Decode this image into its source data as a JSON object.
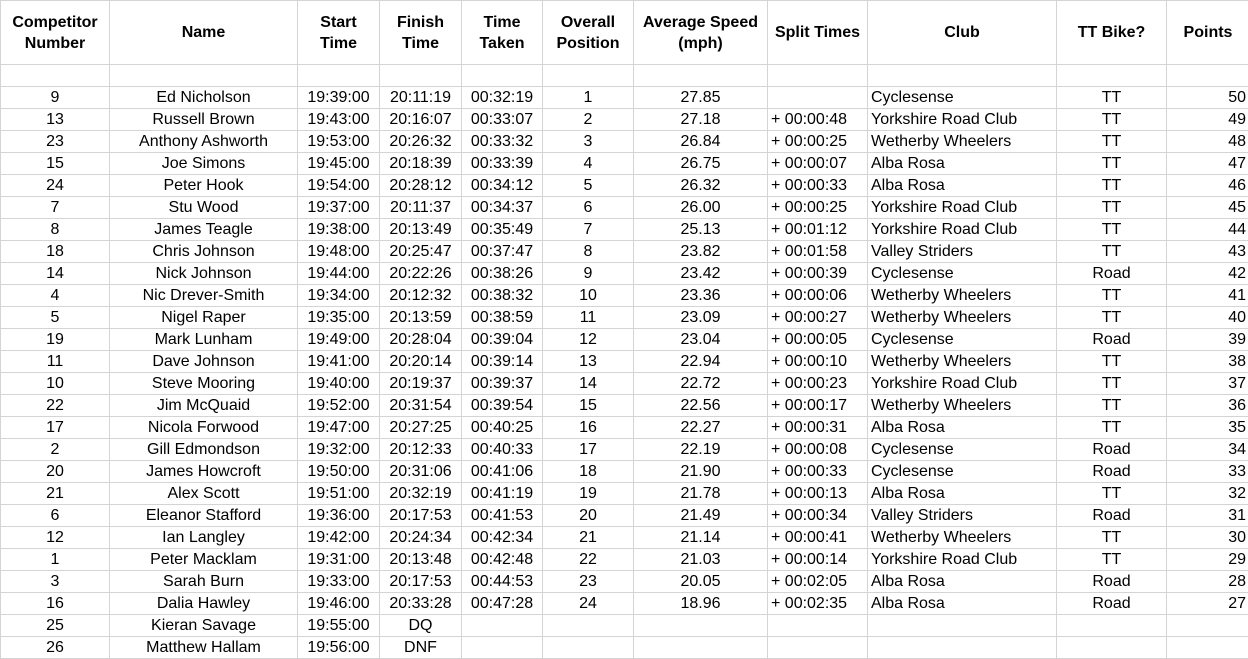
{
  "sheet": {
    "headers": [
      "Competitor Number",
      "Name",
      "Start Time",
      "Finish Time",
      "Time Taken",
      "Overall Position",
      "Average Speed (mph)",
      "Split Times",
      "Club",
      "TT Bike?",
      "Points"
    ],
    "rows": [
      {
        "number": "9",
        "name": "Ed Nicholson",
        "start": "19:39:00",
        "finish": "20:11:19",
        "taken": "00:32:19",
        "position": "1",
        "speed": "27.85",
        "split": "",
        "club": "Cyclesense",
        "bike": "TT",
        "points": "50"
      },
      {
        "number": "13",
        "name": "Russell Brown",
        "start": "19:43:00",
        "finish": "20:16:07",
        "taken": "00:33:07",
        "position": "2",
        "speed": "27.18",
        "split": "+ 00:00:48",
        "club": "Yorkshire Road Club",
        "bike": "TT",
        "points": "49"
      },
      {
        "number": "23",
        "name": "Anthony Ashworth",
        "start": "19:53:00",
        "finish": "20:26:32",
        "taken": "00:33:32",
        "position": "3",
        "speed": "26.84",
        "split": "+ 00:00:25",
        "club": "Wetherby Wheelers",
        "bike": "TT",
        "points": "48"
      },
      {
        "number": "15",
        "name": "Joe Simons",
        "start": "19:45:00",
        "finish": "20:18:39",
        "taken": "00:33:39",
        "position": "4",
        "speed": "26.75",
        "split": "+ 00:00:07",
        "club": "Alba Rosa",
        "bike": "TT",
        "points": "47"
      },
      {
        "number": "24",
        "name": "Peter Hook",
        "start": "19:54:00",
        "finish": "20:28:12",
        "taken": "00:34:12",
        "position": "5",
        "speed": "26.32",
        "split": "+ 00:00:33",
        "club": "Alba Rosa",
        "bike": "TT",
        "points": "46"
      },
      {
        "number": "7",
        "name": "Stu Wood",
        "start": "19:37:00",
        "finish": "20:11:37",
        "taken": "00:34:37",
        "position": "6",
        "speed": "26.00",
        "split": "+ 00:00:25",
        "club": "Yorkshire Road Club",
        "bike": "TT",
        "points": "45"
      },
      {
        "number": "8",
        "name": "James Teagle",
        "start": "19:38:00",
        "finish": "20:13:49",
        "taken": "00:35:49",
        "position": "7",
        "speed": "25.13",
        "split": "+ 00:01:12",
        "club": "Yorkshire Road Club",
        "bike": "TT",
        "points": "44"
      },
      {
        "number": "18",
        "name": "Chris Johnson",
        "start": "19:48:00",
        "finish": "20:25:47",
        "taken": "00:37:47",
        "position": "8",
        "speed": "23.82",
        "split": "+ 00:01:58",
        "club": "Valley Striders",
        "bike": "TT",
        "points": "43"
      },
      {
        "number": "14",
        "name": "Nick Johnson",
        "start": "19:44:00",
        "finish": "20:22:26",
        "taken": "00:38:26",
        "position": "9",
        "speed": "23.42",
        "split": "+ 00:00:39",
        "club": "Cyclesense",
        "bike": "Road",
        "points": "42"
      },
      {
        "number": "4",
        "name": "Nic Drever-Smith",
        "start": "19:34:00",
        "finish": "20:12:32",
        "taken": "00:38:32",
        "position": "10",
        "speed": "23.36",
        "split": "+ 00:00:06",
        "club": "Wetherby Wheelers",
        "bike": "TT",
        "points": "41"
      },
      {
        "number": "5",
        "name": "Nigel Raper",
        "start": "19:35:00",
        "finish": "20:13:59",
        "taken": "00:38:59",
        "position": "11",
        "speed": "23.09",
        "split": "+ 00:00:27",
        "club": "Wetherby Wheelers",
        "bike": "TT",
        "points": "40"
      },
      {
        "number": "19",
        "name": "Mark Lunham",
        "start": "19:49:00",
        "finish": "20:28:04",
        "taken": "00:39:04",
        "position": "12",
        "speed": "23.04",
        "split": "+ 00:00:05",
        "club": "Cyclesense",
        "bike": "Road",
        "points": "39"
      },
      {
        "number": "11",
        "name": "Dave Johnson",
        "start": "19:41:00",
        "finish": "20:20:14",
        "taken": "00:39:14",
        "position": "13",
        "speed": "22.94",
        "split": "+ 00:00:10",
        "club": "Wetherby Wheelers",
        "bike": "TT",
        "points": "38"
      },
      {
        "number": "10",
        "name": "Steve Mooring",
        "start": "19:40:00",
        "finish": "20:19:37",
        "taken": "00:39:37",
        "position": "14",
        "speed": "22.72",
        "split": "+ 00:00:23",
        "club": "Yorkshire Road Club",
        "bike": "TT",
        "points": "37"
      },
      {
        "number": "22",
        "name": "Jim McQuaid",
        "start": "19:52:00",
        "finish": "20:31:54",
        "taken": "00:39:54",
        "position": "15",
        "speed": "22.56",
        "split": "+ 00:00:17",
        "club": "Wetherby Wheelers",
        "bike": "TT",
        "points": "36"
      },
      {
        "number": "17",
        "name": "Nicola Forwood",
        "start": "19:47:00",
        "finish": "20:27:25",
        "taken": "00:40:25",
        "position": "16",
        "speed": "22.27",
        "split": "+ 00:00:31",
        "club": "Alba Rosa",
        "bike": "TT",
        "points": "35"
      },
      {
        "number": "2",
        "name": "Gill Edmondson",
        "start": "19:32:00",
        "finish": "20:12:33",
        "taken": "00:40:33",
        "position": "17",
        "speed": "22.19",
        "split": "+ 00:00:08",
        "club": "Cyclesense",
        "bike": "Road",
        "points": "34"
      },
      {
        "number": "20",
        "name": "James Howcroft",
        "start": "19:50:00",
        "finish": "20:31:06",
        "taken": "00:41:06",
        "position": "18",
        "speed": "21.90",
        "split": "+ 00:00:33",
        "club": "Cyclesense",
        "bike": "Road",
        "points": "33"
      },
      {
        "number": "21",
        "name": "Alex Scott",
        "start": "19:51:00",
        "finish": "20:32:19",
        "taken": "00:41:19",
        "position": "19",
        "speed": "21.78",
        "split": "+ 00:00:13",
        "club": "Alba Rosa",
        "bike": "TT",
        "points": "32"
      },
      {
        "number": "6",
        "name": "Eleanor Stafford",
        "start": "19:36:00",
        "finish": "20:17:53",
        "taken": "00:41:53",
        "position": "20",
        "speed": "21.49",
        "split": "+ 00:00:34",
        "club": "Valley Striders",
        "bike": "Road",
        "points": "31"
      },
      {
        "number": "12",
        "name": "Ian Langley",
        "start": "19:42:00",
        "finish": "20:24:34",
        "taken": "00:42:34",
        "position": "21",
        "speed": "21.14",
        "split": "+ 00:00:41",
        "club": "Wetherby Wheelers",
        "bike": "TT",
        "points": "30"
      },
      {
        "number": "1",
        "name": "Peter Macklam",
        "start": "19:31:00",
        "finish": "20:13:48",
        "taken": "00:42:48",
        "position": "22",
        "speed": "21.03",
        "split": "+ 00:00:14",
        "club": "Yorkshire Road Club",
        "bike": "TT",
        "points": "29"
      },
      {
        "number": "3",
        "name": "Sarah Burn",
        "start": "19:33:00",
        "finish": "20:17:53",
        "taken": "00:44:53",
        "position": "23",
        "speed": "20.05",
        "split": "+ 00:02:05",
        "club": "Alba Rosa",
        "bike": "Road",
        "points": "28"
      },
      {
        "number": "16",
        "name": "Dalia Hawley",
        "start": "19:46:00",
        "finish": "20:33:28",
        "taken": "00:47:28",
        "position": "24",
        "speed": "18.96",
        "split": "+ 00:02:35",
        "club": "Alba Rosa",
        "bike": "Road",
        "points": "27"
      },
      {
        "number": "25",
        "name": "Kieran Savage",
        "start": "19:55:00",
        "finish": "DQ",
        "taken": "",
        "position": "",
        "speed": "",
        "split": "",
        "club": "",
        "bike": "",
        "points": ""
      },
      {
        "number": "26",
        "name": "Matthew Hallam",
        "start": "19:56:00",
        "finish": "DNF",
        "taken": "",
        "position": "",
        "speed": "",
        "split": "",
        "club": "",
        "bike": "",
        "points": ""
      }
    ]
  }
}
